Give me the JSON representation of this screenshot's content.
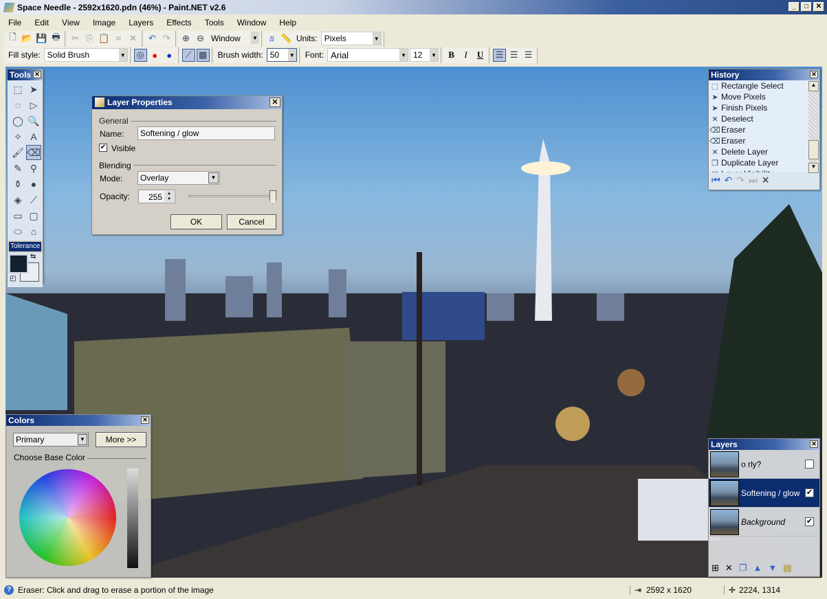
{
  "window": {
    "title": "Space Needle - 2592x1620.pdn (46%) - Paint.NET v2.6",
    "min": "_",
    "max": "□",
    "close": "✕"
  },
  "menu": [
    "File",
    "Edit",
    "View",
    "Image",
    "Layers",
    "Effects",
    "Tools",
    "Window",
    "Help"
  ],
  "toolbar": {
    "zoom_value": "Window",
    "units_label": "Units:",
    "units_value": "Pixels"
  },
  "toolbar2": {
    "fill_label": "Fill style:",
    "fill_value": "Solid Brush",
    "brush_label": "Brush width:",
    "brush_value": "50",
    "font_label": "Font:",
    "font_value": "Arial",
    "font_size": "12",
    "bold": "B",
    "italic": "I",
    "underline": "U"
  },
  "tools": {
    "title": "Tools",
    "tolerance": "Tolerance",
    "primary_color": "#14202e",
    "secondary_color": "#e8eef4",
    "items": [
      {
        "n": "rectangle-select-icon",
        "g": "⬚"
      },
      {
        "n": "move-selection-icon",
        "g": "➤"
      },
      {
        "n": "lasso-select-icon",
        "g": "◌"
      },
      {
        "n": "move-selected-icon",
        "g": "▷"
      },
      {
        "n": "ellipse-select-icon",
        "g": "◯"
      },
      {
        "n": "zoom-icon",
        "g": "🔍"
      },
      {
        "n": "magic-wand-icon",
        "g": "✧"
      },
      {
        "n": "text-icon",
        "g": "A"
      },
      {
        "n": "paintbrush-icon",
        "g": "🖌"
      },
      {
        "n": "eraser-icon",
        "g": "⌫"
      },
      {
        "n": "pencil-icon",
        "g": "✎"
      },
      {
        "n": "color-picker-icon",
        "g": "⚲"
      },
      {
        "n": "clone-stamp-icon",
        "g": "⚱"
      },
      {
        "n": "recolor-icon",
        "g": "●"
      },
      {
        "n": "paint-bucket-icon",
        "g": "◈"
      },
      {
        "n": "line-curve-icon",
        "g": "⟋"
      },
      {
        "n": "rectangle-icon",
        "g": "▭"
      },
      {
        "n": "rounded-rectangle-icon",
        "g": "▢"
      },
      {
        "n": "ellipse-icon",
        "g": "⬭"
      },
      {
        "n": "freeform-shape-icon",
        "g": "⌂"
      }
    ]
  },
  "layer_properties": {
    "title": "Layer Properties",
    "general": "General",
    "name_label": "Name:",
    "name_value": "Softening / glow",
    "visible_label": "Visible",
    "visible": true,
    "blending": "Blending",
    "mode_label": "Mode:",
    "mode_value": "Overlay",
    "opacity_label": "Opacity:",
    "opacity_value": "255",
    "ok": "OK",
    "cancel": "Cancel"
  },
  "history": {
    "title": "History",
    "items": [
      {
        "label": "Rectangle Select",
        "icon": "⬚"
      },
      {
        "label": "Move Pixels",
        "icon": "➤"
      },
      {
        "label": "Finish Pixels",
        "icon": "➤"
      },
      {
        "label": "Deselect",
        "icon": "✕"
      },
      {
        "label": "Eraser",
        "icon": "⌫"
      },
      {
        "label": "Eraser",
        "icon": "⌫"
      },
      {
        "label": "Delete Layer",
        "icon": "✕"
      },
      {
        "label": "Duplicate Layer",
        "icon": "❐"
      },
      {
        "label": "Layer Visibility",
        "icon": "◪"
      }
    ]
  },
  "colors": {
    "title": "Colors",
    "select_value": "Primary",
    "more": "More >>",
    "choose": "Choose Base Color"
  },
  "layers": {
    "title": "Layers",
    "items": [
      {
        "name": "o rly?",
        "visible": false,
        "selected": false
      },
      {
        "name": "Softening / glow",
        "visible": true,
        "selected": true
      },
      {
        "name": "Background",
        "visible": true,
        "selected": false
      }
    ]
  },
  "status": {
    "message": "Eraser: Click and drag to erase a portion of the image",
    "image_size": "2592 x 1620",
    "cursor": "2224, 1314"
  }
}
